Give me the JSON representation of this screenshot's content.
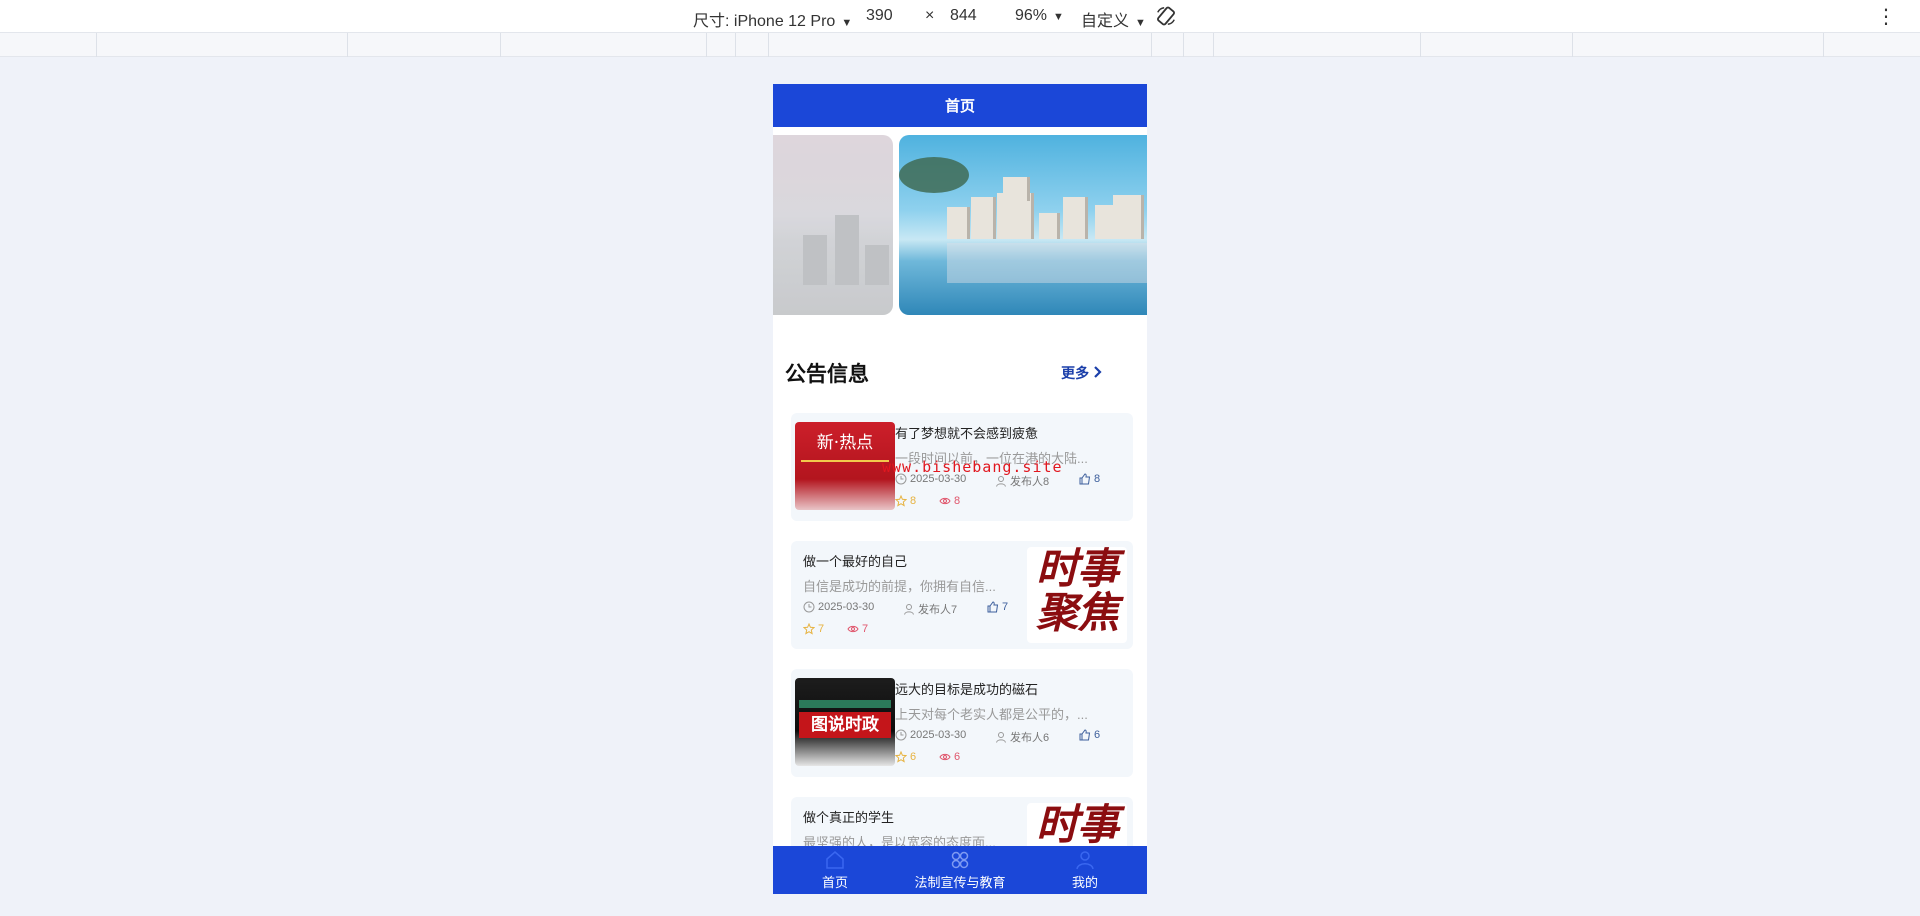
{
  "devtools": {
    "device_label": "尺寸: iPhone 12 Pro",
    "width": "390",
    "times": "×",
    "height": "844",
    "zoom": "96%",
    "mode": "自定义"
  },
  "navbar": {
    "title": "首页"
  },
  "section": {
    "title": "公告信息",
    "more": "更多"
  },
  "watermark": "www.bishebang.site",
  "thumbs": {
    "hot": "新·热点",
    "focus_line1": "时事",
    "focus_line2": "聚焦",
    "graphic": "图说时政"
  },
  "cards": [
    {
      "title": "有了梦想就不会感到疲惫",
      "desc": "一段时间以前，一位在港的大陆...",
      "date": "2025-03-30",
      "author": "发布人8",
      "likes": "8",
      "favs": "8",
      "views": "8"
    },
    {
      "title": "做一个最好的自己",
      "desc": "自信是成功的前提，你拥有自信...",
      "date": "2025-03-30",
      "author": "发布人7",
      "likes": "7",
      "favs": "7",
      "views": "7"
    },
    {
      "title": "远大的目标是成功的磁石",
      "desc": "上天对每个老实人都是公平的，...",
      "date": "2025-03-30",
      "author": "发布人6",
      "likes": "6",
      "favs": "6",
      "views": "6"
    },
    {
      "title": "做个真正的学生",
      "desc": "最坚强的人，是以宽容的态度面..."
    }
  ],
  "tabbar": {
    "home": "首页",
    "edu": "法制宣传与教育",
    "me": "我的"
  },
  "colors": {
    "primary": "#1b47d8",
    "like": "#3d5f9c",
    "fav": "#e7b341",
    "view": "#e0566c"
  }
}
